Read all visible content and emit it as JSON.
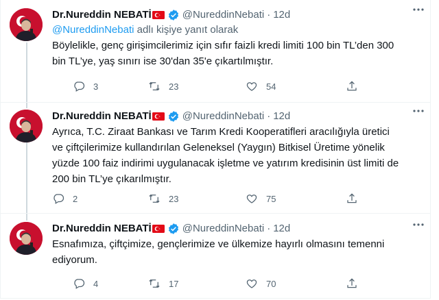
{
  "colors": {
    "accent": "#1d9bf0",
    "muted": "#536471",
    "text": "#0f1419",
    "border": "#eff3f4"
  },
  "icons": {
    "reply": "reply-icon",
    "retweet": "retweet-icon",
    "like": "like-icon",
    "share": "share-icon",
    "verified": "verified-badge-icon",
    "flag": "turkish-flag-icon",
    "more": "more-icon"
  },
  "tweets": [
    {
      "name": "Dr.Nureddin NEBATİ",
      "handle": "@NureddinNebati",
      "dot": "·",
      "time": "12d",
      "replying_mention": "@NureddinNebati",
      "replying_suffix": " adlı kişiye yanıt olarak",
      "text": "Böylelikle, genç girişimcilerimiz için sıfır faizli kredi limiti 100 bin TL’den 300\nbin TL’ye, yaş sınırı ise 30'dan 35'e çıkartılmıştır.",
      "replies": "3",
      "retweets": "23",
      "likes": "54"
    },
    {
      "name": "Dr.Nureddin NEBATİ",
      "handle": "@NureddinNebati",
      "dot": "·",
      "time": "12d",
      "text": "Ayrıca, T.C. Ziraat Bankası ve Tarım Kredi Kooperatifleri aracılığıyla üretici\nve çiftçilerimize kullandırılan Geleneksel (Yaygın) Bitkisel Üretime yönelik\nyüzde 100 faiz indirimi uygulanacak işletme ve yatırım kredisinin üst limiti de\n200 bin TL’ye çıkarılmıştır.",
      "replies": "2",
      "retweets": "23",
      "likes": "75"
    },
    {
      "name": "Dr.Nureddin NEBATİ",
      "handle": "@NureddinNebati",
      "dot": "·",
      "time": "12d",
      "text": "Esnafımıza, çiftçimize, gençlerimize ve ülkemize hayırlı olmasını temenni\nediyorum.",
      "replies": "4",
      "retweets": "17",
      "likes": "70"
    }
  ]
}
